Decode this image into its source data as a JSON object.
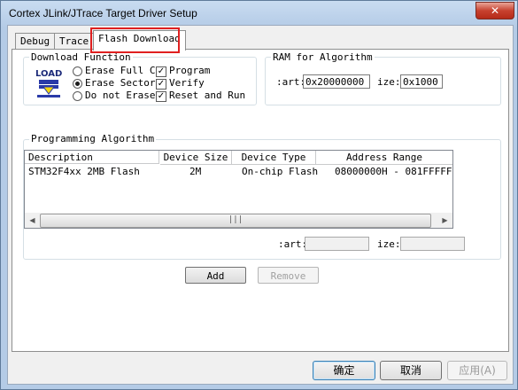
{
  "window": {
    "title": "Cortex JLink/JTrace Target Driver Setup",
    "close_glyph": "✕"
  },
  "tabs": [
    {
      "label": "Debug"
    },
    {
      "label": "Trace"
    },
    {
      "label": "Flash Download"
    }
  ],
  "download_function": {
    "legend": "Download Function",
    "icon_label": "LOAD",
    "radios": [
      {
        "label": "Erase Full C",
        "checked": false
      },
      {
        "label": "Erase Sector",
        "checked": true
      },
      {
        "label": "Do not Erase",
        "checked": false
      }
    ],
    "checkboxes": [
      {
        "label": "Program",
        "checked": true
      },
      {
        "label": "Verify",
        "checked": true
      },
      {
        "label": "Reset and Run",
        "checked": true
      }
    ]
  },
  "ram": {
    "legend": "RAM for Algorithm",
    "start_label": ":art:",
    "start_value": "0x20000000",
    "size_label": "ize:",
    "size_value": "0x1000"
  },
  "programming": {
    "legend": "Programming Algorithm",
    "columns": [
      "Description",
      "Device Size",
      "Device Type",
      "Address Range"
    ],
    "rows": [
      {
        "description": "STM32F4xx 2MB Flash",
        "size": "2M",
        "type": "On-chip Flash",
        "range": "08000000H - 081FFFFFH"
      }
    ],
    "scroll_thumb_grip": "|||",
    "scroll_left_glyph": "◀",
    "scroll_right_glyph": "▶",
    "start_label": ":art:",
    "start_value": "",
    "size_label": "ize:",
    "size_value": ""
  },
  "buttons": {
    "add": "Add",
    "remove": "Remove"
  },
  "footer": {
    "ok": "确定",
    "cancel": "取消",
    "apply": "应用(A)"
  }
}
